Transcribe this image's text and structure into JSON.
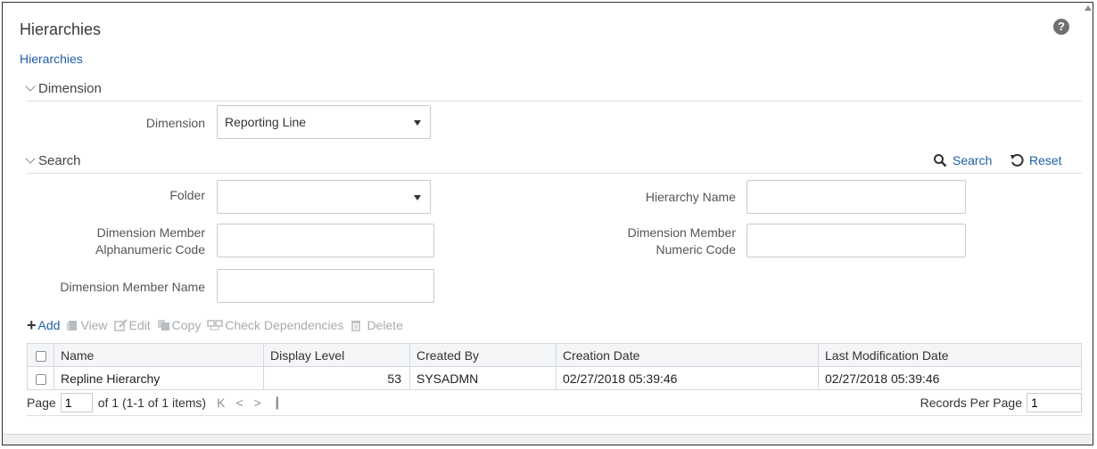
{
  "page": {
    "title": "Hierarchies",
    "breadcrumb": "Hierarchies",
    "help_icon": "help-icon"
  },
  "dimension_section": {
    "heading": "Dimension",
    "dimension_label": "Dimension",
    "dimension_value": "Reporting Line"
  },
  "search_section": {
    "heading": "Search",
    "search_label": "Search",
    "reset_label": "Reset",
    "folder_label": "Folder",
    "folder_value": "",
    "hierarchy_name_label": "Hierarchy Name",
    "hierarchy_name_value": "",
    "alpha_code_label_line1": "Dimension Member",
    "alpha_code_label_line2": "Alphanumeric Code",
    "alpha_code_value": "",
    "numeric_code_label_line1": "Dimension Member",
    "numeric_code_label_line2": "Numeric Code",
    "numeric_code_value": "",
    "member_name_label": "Dimension Member Name",
    "member_name_value": ""
  },
  "toolbar": {
    "add": "Add",
    "view": "View",
    "edit": "Edit",
    "copy": "Copy",
    "check_dependencies": "Check Dependencies",
    "delete": "Delete"
  },
  "table": {
    "columns": [
      "Name",
      "Display Level",
      "Created By",
      "Creation Date",
      "Last Modification Date"
    ],
    "rows": [
      {
        "name": "Repline Hierarchy",
        "display_level": "53",
        "created_by": "SYSADMN",
        "creation_date": "02/27/2018 05:39:46",
        "last_modification_date": "02/27/2018 05:39:46"
      }
    ]
  },
  "pagination": {
    "page_label": "Page",
    "page_value": "1",
    "page_info": "of 1 (1-1 of 1 items)",
    "first": "K",
    "prev": "<",
    "next": ">",
    "last": "❙",
    "records_per_page_label": "Records Per Page",
    "records_per_page_value": "1"
  },
  "colors": {
    "link": "#1d5fa6",
    "disabled": "#a7aaae",
    "header_bg": "#f4f5f7"
  }
}
